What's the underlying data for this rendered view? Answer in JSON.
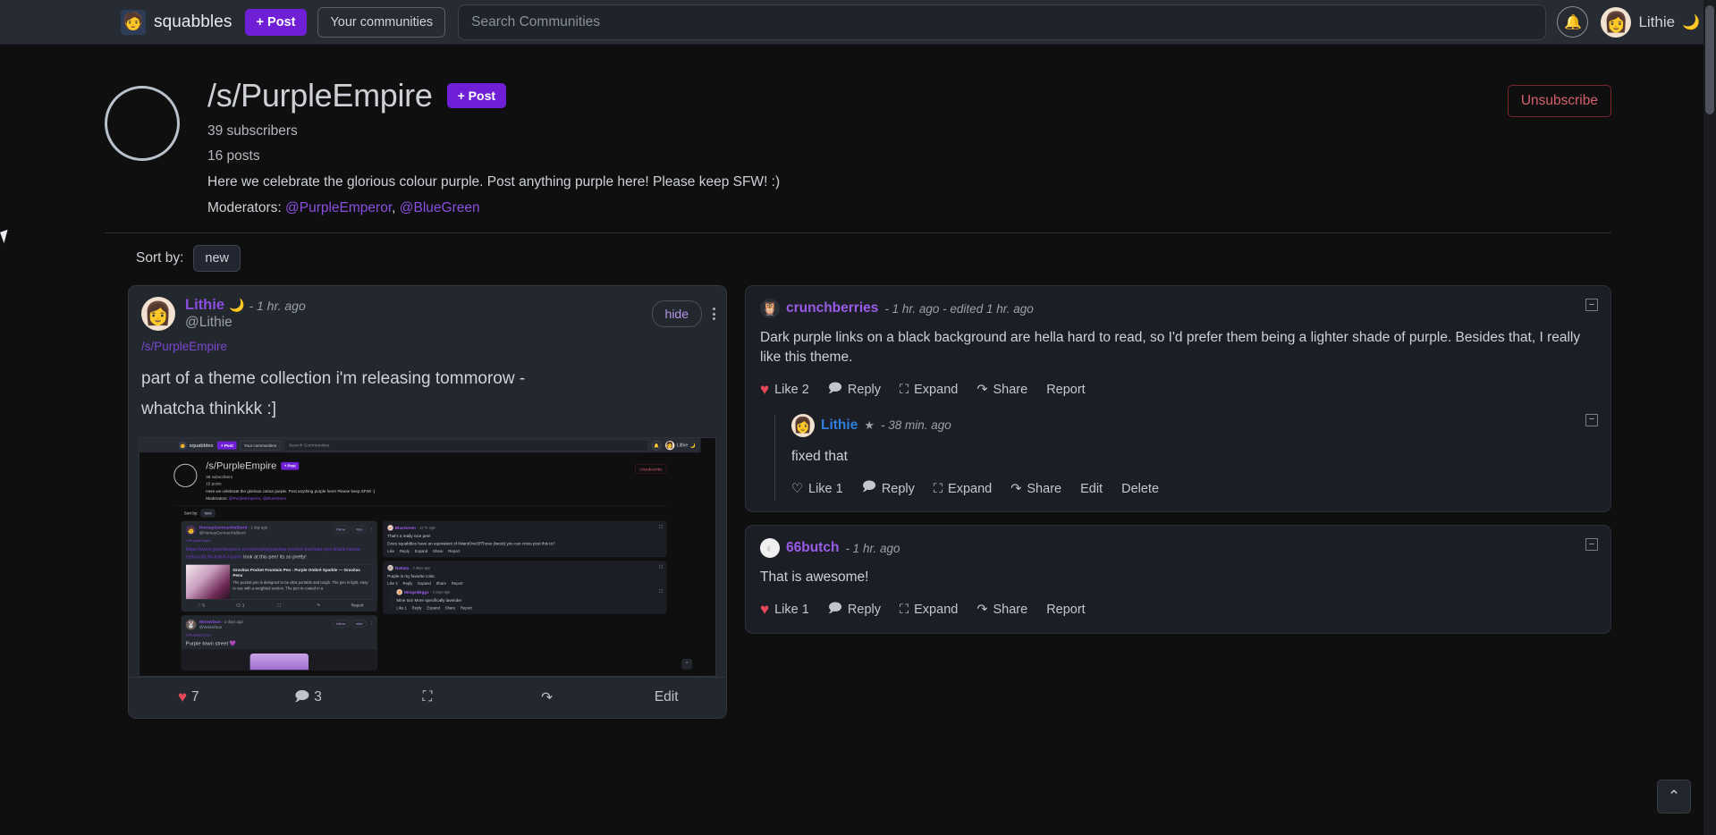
{
  "navbar": {
    "brand_name": "squabbles",
    "brand_avatar_icon": "person-avatar-icon",
    "post_button": "+ Post",
    "communities_button": "Your communities",
    "search_placeholder": "Search Communities",
    "search_value": "",
    "bell_icon": "notification-bell-icon",
    "user_name": "Lithie",
    "user_avatar_icon": "user-avatar-icon",
    "theme_icon": "crescent-moon-icon"
  },
  "community": {
    "avatar_icon": "community-avatar-placeholder-icon",
    "title": "/s/PurpleEmpire",
    "post_button": "+ Post",
    "subscribers": "39 subscribers",
    "posts": "16 posts",
    "description": "Here we celebrate the glorious colour purple. Post anything purple here! Please keep SFW! :)",
    "moderators_label": "Moderators:",
    "moderators": [
      "@PurpleEmperor",
      "@BlueGreen"
    ],
    "unsubscribe_button": "Unsubscribe"
  },
  "sort": {
    "label": "Sort by:",
    "value": "new"
  },
  "post": {
    "author": "Lithie",
    "author_badge_icon": "crescent-moon-icon",
    "time": "- 1 hr. ago",
    "handle": "@Lithie",
    "hide_button": "hide",
    "kebab_icon": "more-options-icon",
    "community_link": "/s/PurpleEmpire",
    "title_line1": "part of a theme collection i'm releasing tommorow -",
    "title_line2": "whatcha thinkkk :]",
    "image_alt": "screenshot-of-purpleempire-theme",
    "actions": {
      "like_icon": "heart-filled-icon",
      "like_count": "7",
      "comment_icon": "comment-bubble-icon",
      "comment_count": "3",
      "expand_icon": "expand-icon",
      "share_icon": "share-icon",
      "edit_label": "Edit"
    }
  },
  "embedded_screenshot": {
    "navbar": {
      "brand_name": "squabbles",
      "post_button": "+ Post",
      "communities_button": "Your communities",
      "search_placeholder": "Search Communities",
      "user_name": "Lithie"
    },
    "community": {
      "title": "/s/PurpleEmpire",
      "post_button": "+ Post",
      "subscribers": "38 subscribers",
      "posts": "15 posts",
      "description": "Here we celebrate the glorious colour purple. Post anything purple here! Please keep SFW! :)",
      "moderators_label": "Moderators:",
      "moderators": [
        "@PurpleEmperor",
        "@BlueGreen"
      ],
      "unsubscribe_button": "Unsubscribe"
    },
    "sort": {
      "label": "Sort by:",
      "value": "new"
    },
    "posts": [
      {
        "author": "HornayGermanHalberd",
        "time": "- 1 day ago",
        "handle": "@HornayGermanHalberd",
        "follow_button": "follow",
        "hide_button": "hide",
        "community_link": "/s/PurpleEmpire",
        "link_text": "https://www.gravitaspens.com/shop/p/gravitas-pocket-fountain-pen-black-lawne-ey9na-l8chb-kdei5-hparm",
        "body_text": " look at this pen! its so pretty!",
        "preview_title": "Gravitas Pocket Fountain Pen - Purple Ombré Sparkle — Gravitas Pens",
        "preview_desc": "The pocket pen is designed to be ultra portable and tough. The pen is light, easy to use with a weighted section. The pen is coated in a",
        "like_count": "5",
        "comment_count": "1",
        "report_label": "Report"
      },
      {
        "author": "Winterbun",
        "time": "- 2 days ago",
        "handle": "@Winterbun",
        "follow_button": "follow",
        "hide_button": "hide",
        "community_link": "/s/PurpleEmpire",
        "body_text": "Purple town street 💜"
      }
    ],
    "comments": [
      {
        "author": "BlueGreen",
        "time": "- 12 hr. ago",
        "text_line1": "That's a really nice pen!",
        "text_line2": "Does squabbles have an equivalent of IWantOneOfThose (iwoot) you can cross post this to?",
        "actions": [
          "Like",
          "Reply",
          "Expand",
          "Share",
          "Report"
        ]
      },
      {
        "author": "Rattata",
        "time": "- 2 days ago",
        "text_line1": "Purple is my favorite color.",
        "actions": [
          "Like 3",
          "Reply",
          "Expand",
          "Share",
          "Report"
        ],
        "reply": {
          "author": "WingedEggs",
          "time": "- 2 days ago",
          "text_line1": "Mine too! More specifically lavender",
          "actions": [
            "Like 1",
            "Reply",
            "Expand",
            "Share",
            "Report"
          ]
        }
      }
    ]
  },
  "comments": [
    {
      "id": "crunchberries",
      "avatar_icon": "crunchberries-avatar-icon",
      "author": "crunchberries",
      "author_color": "#9a5ce8",
      "meta": "- 1 hr. ago - edited 1 hr. ago",
      "text": "Dark purple links on a black background are hella hard to read, so I'd prefer them being a lighter shade of purple. Besides that, I really like this theme.",
      "collapse_icon": "collapse-minus-icon",
      "actions": {
        "like_icon": "heart-filled-icon",
        "like_label": "Like 2",
        "reply_label": "Reply",
        "expand_label": "Expand",
        "share_label": "Share",
        "last_label": "Report"
      },
      "reply": {
        "avatar_icon": "lithie-avatar-icon",
        "author": "Lithie",
        "author_color": "#2f7fe0",
        "badge_icon": "star-icon",
        "meta": "- 38 min. ago",
        "text": "fixed that",
        "collapse_icon": "collapse-minus-icon",
        "actions": {
          "like_icon": "heart-outline-icon",
          "like_label": "Like 1",
          "reply_label": "Reply",
          "expand_label": "Expand",
          "share_label": "Share",
          "edit_label": "Edit",
          "delete_label": "Delete"
        }
      }
    },
    {
      "id": "66butch",
      "avatar_icon": "66butch-avatar-icon",
      "author": "66butch",
      "author_color": "#9a5ce8",
      "meta": "- 1 hr. ago",
      "text": "That is awesome!",
      "collapse_icon": "collapse-minus-icon",
      "actions": {
        "like_icon": "heart-filled-icon",
        "like_label": "Like 1",
        "reply_label": "Reply",
        "expand_label": "Expand",
        "share_label": "Share",
        "last_label": "Report"
      }
    }
  ],
  "chrome": {
    "back_to_top_icon": "chevron-up-icon",
    "scrollbar": "vertical-scrollbar"
  },
  "colors": {
    "accent_purple": "#6f1fd6",
    "link_purple": "#8a4fe0",
    "heart_red": "#e6485a",
    "unsubscribe_red": "#d3606c",
    "blue_name": "#2f7fe0",
    "navbar_bg": "#272b33",
    "page_bg": "#0f0f10",
    "card_bg": "#23272e",
    "comment_bg": "#1b1e24"
  }
}
